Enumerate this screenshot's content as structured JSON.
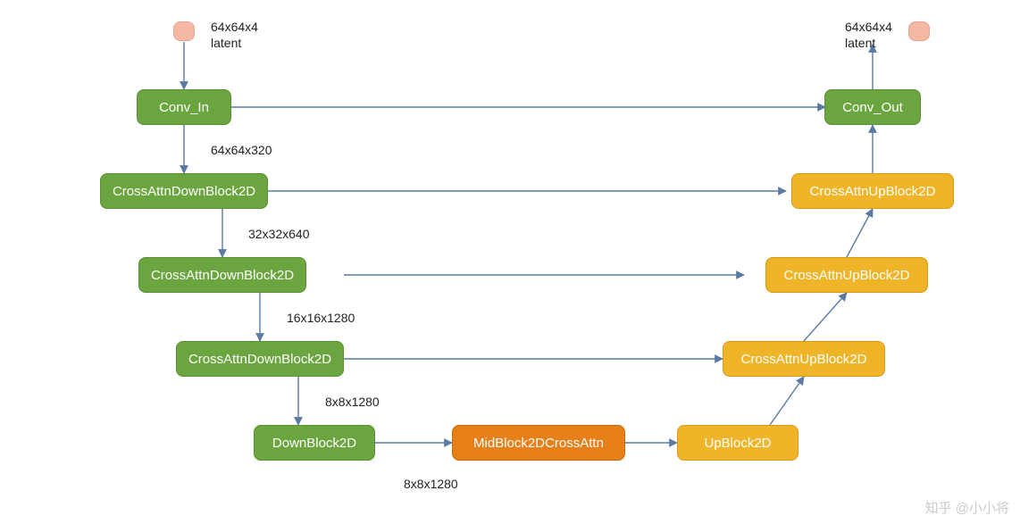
{
  "input": {
    "shape": "64x64x4\nlatent"
  },
  "output": {
    "shape": "64x64x4\nlatent"
  },
  "down": {
    "conv_in": "Conv_In",
    "d1": "CrossAttnDownBlock2D",
    "d2": "CrossAttnDownBlock2D",
    "d3": "CrossAttnDownBlock2D",
    "d4": "DownBlock2D"
  },
  "mid": {
    "block": "MidBlock2DCrossAttn"
  },
  "up": {
    "u4": "UpBlock2D",
    "u3": "CrossAttnUpBlock2D",
    "u2": "CrossAttnUpBlock2D",
    "u1": "CrossAttnUpBlock2D",
    "conv_out": "Conv_Out"
  },
  "tensors": {
    "s0": "64x64x320",
    "s1": "32x32x640",
    "s2": "16x16x1280",
    "s3": "8x8x1280",
    "s4": "8x8x1280"
  },
  "watermark": "知乎 @小小将"
}
